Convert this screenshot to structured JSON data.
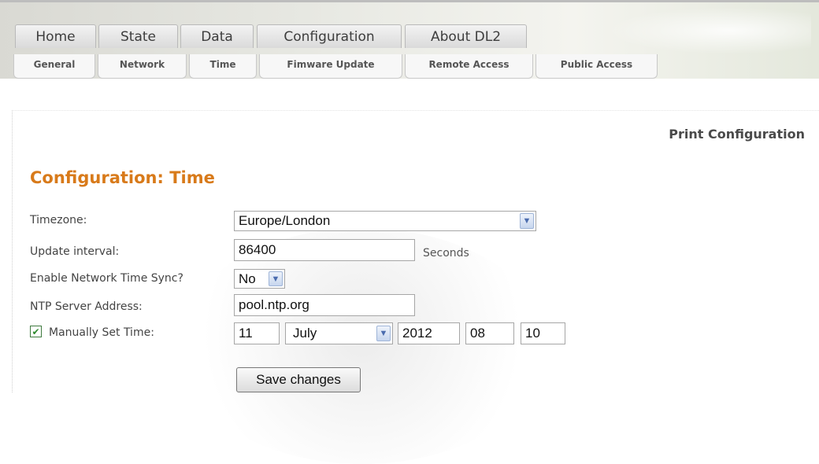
{
  "main_tabs": [
    {
      "label": "Home"
    },
    {
      "label": "State"
    },
    {
      "label": "Data"
    },
    {
      "label": "Configuration"
    },
    {
      "label": "About DL2"
    }
  ],
  "sub_tabs": [
    {
      "label": "General"
    },
    {
      "label": "Network"
    },
    {
      "label": "Time"
    },
    {
      "label": "Fimware Update"
    },
    {
      "label": "Remote Access"
    },
    {
      "label": "Public Access"
    }
  ],
  "print_link": "Print Configuration",
  "page_title": "Configuration: Time",
  "form": {
    "timezone": {
      "label": "Timezone:",
      "value": "Europe/London"
    },
    "update_interval": {
      "label": "Update interval:",
      "value": "86400",
      "unit": "Seconds"
    },
    "network_sync": {
      "label": "Enable Network Time Sync?",
      "value": "No"
    },
    "ntp_server": {
      "label": "NTP Server Address:",
      "value": "pool.ntp.org"
    },
    "manual_time": {
      "label": "Manually Set Time:",
      "checked": true,
      "day": "11",
      "month": "July",
      "year": "2012",
      "hour": "08",
      "minute": "10"
    },
    "save_label": "Save changes"
  },
  "colors": {
    "title": "#d87a1a",
    "checkbox_check": "#2e8b2e",
    "select_arrow": "#4b6cae"
  },
  "icons": {
    "dropdown": "chevron-down-icon",
    "check": "checkmark-icon"
  }
}
